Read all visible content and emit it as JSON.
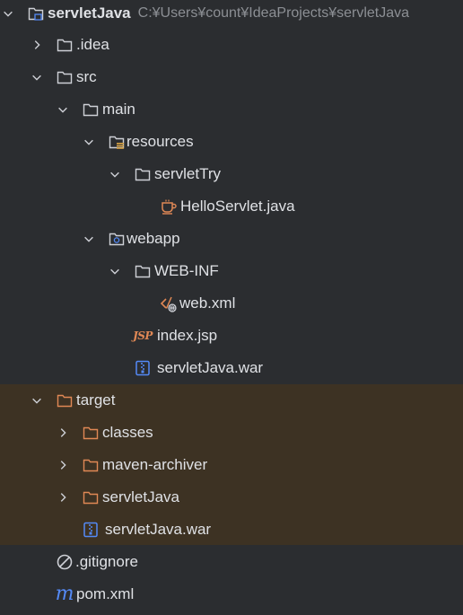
{
  "colors": {
    "background": "#2b2d30",
    "excluded_background": "#3d3223",
    "text": "#dfe1e5",
    "path_text": "#8c8f94",
    "folder_outline": "#ced0d6",
    "excluded_folder": "#e08855",
    "java_icon": "#e08855",
    "war_icon": "#548af7",
    "maven_icon": "#548af7"
  },
  "project": {
    "name": "servletJava",
    "path": "C:¥Users¥count¥IdeaProjects¥servletJava"
  },
  "nodes": [
    {
      "label": "servletJava",
      "icon": "module-folder-icon",
      "expanded": true,
      "excluded": false
    },
    {
      "label": ".idea",
      "icon": "folder-icon",
      "expanded": false,
      "excluded": false
    },
    {
      "label": "src",
      "icon": "folder-icon",
      "expanded": true,
      "excluded": false
    },
    {
      "label": "main",
      "icon": "folder-icon",
      "expanded": true,
      "excluded": false
    },
    {
      "label": "resources",
      "icon": "resources-folder-icon",
      "expanded": true,
      "excluded": false
    },
    {
      "label": "servletTry",
      "icon": "folder-icon",
      "expanded": true,
      "excluded": false
    },
    {
      "label": "HelloServlet.java",
      "icon": "java-file-icon",
      "excluded": false
    },
    {
      "label": "webapp",
      "icon": "web-folder-icon",
      "expanded": true,
      "excluded": false
    },
    {
      "label": "WEB-INF",
      "icon": "folder-icon",
      "expanded": true,
      "excluded": false
    },
    {
      "label": "web.xml",
      "icon": "web-xml-icon",
      "excluded": false
    },
    {
      "label": "index.jsp",
      "icon": "jsp-file-icon",
      "icon_text": "JSP",
      "excluded": false
    },
    {
      "label": "servletJava.war",
      "icon": "war-file-icon",
      "excluded": false
    },
    {
      "label": "target",
      "icon": "excluded-folder-icon",
      "expanded": true,
      "excluded": true
    },
    {
      "label": "classes",
      "icon": "excluded-folder-icon",
      "expanded": false,
      "excluded": true
    },
    {
      "label": "maven-archiver",
      "icon": "excluded-folder-icon",
      "expanded": false,
      "excluded": true
    },
    {
      "label": "servletJava",
      "icon": "excluded-folder-icon",
      "expanded": false,
      "excluded": true
    },
    {
      "label": "servletJava.war",
      "icon": "war-file-icon",
      "excluded": true
    },
    {
      "label": ".gitignore",
      "icon": "ignore-file-icon",
      "excluded": false
    },
    {
      "label": "pom.xml",
      "icon": "maven-file-icon",
      "icon_text": "m",
      "excluded": false
    }
  ]
}
